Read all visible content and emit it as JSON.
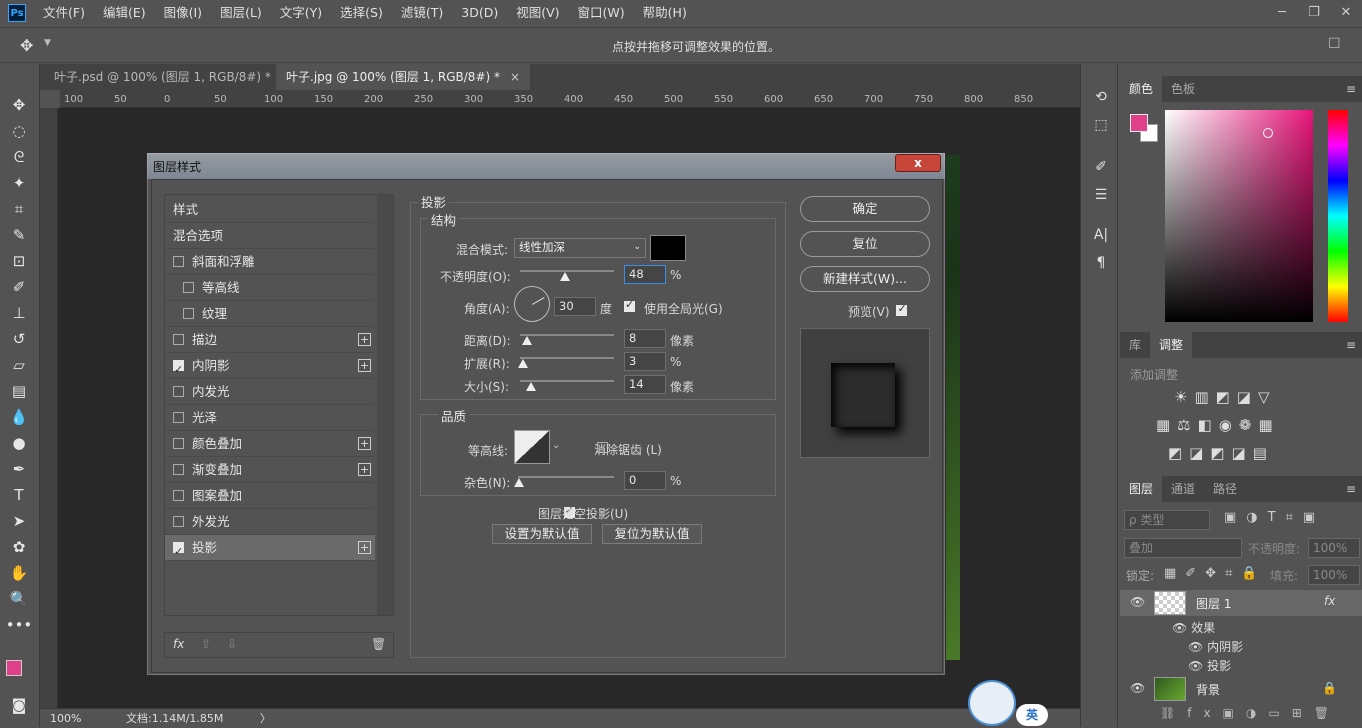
{
  "app": {
    "logo": "Ps"
  },
  "menu": [
    "文件(F)",
    "编辑(E)",
    "图像(I)",
    "图层(L)",
    "文字(Y)",
    "选择(S)",
    "滤镜(T)",
    "3D(D)",
    "视图(V)",
    "窗口(W)",
    "帮助(H)"
  ],
  "options_bar": {
    "hint": "点按并拖移可调整效果的位置。"
  },
  "doc_tabs": [
    {
      "label": "叶子.psd @ 100% (图层 1, RGB/8#) *",
      "close": "×"
    },
    {
      "label": "叶子.jpg @ 100% (图层 1, RGB/8#) *",
      "close": "×"
    }
  ],
  "ruler_h": [
    "100",
    "50",
    "0",
    "50",
    "100",
    "150",
    "200",
    "250",
    "300",
    "350",
    "400",
    "450",
    "500",
    "550",
    "600",
    "650",
    "700",
    "750",
    "800",
    "850"
  ],
  "status": {
    "zoom": "100%",
    "doc": "文档:1.14M/1.85M",
    "arrow": "〉"
  },
  "dialog": {
    "title": "图层样式",
    "close": "x",
    "styles": [
      {
        "label": "样式",
        "checkbox": null,
        "plus": false,
        "indent": false
      },
      {
        "label": "混合选项",
        "checkbox": null,
        "plus": false,
        "indent": false
      },
      {
        "label": "斜面和浮雕",
        "checkbox": false,
        "plus": false,
        "indent": false
      },
      {
        "label": "等高线",
        "checkbox": false,
        "plus": false,
        "indent": true
      },
      {
        "label": "纹理",
        "checkbox": false,
        "plus": false,
        "indent": true
      },
      {
        "label": "描边",
        "checkbox": false,
        "plus": true,
        "indent": false
      },
      {
        "label": "内阴影",
        "checkbox": true,
        "plus": true,
        "indent": false
      },
      {
        "label": "内发光",
        "checkbox": false,
        "plus": false,
        "indent": false
      },
      {
        "label": "光泽",
        "checkbox": false,
        "plus": false,
        "indent": false
      },
      {
        "label": "颜色叠加",
        "checkbox": false,
        "plus": true,
        "indent": false
      },
      {
        "label": "渐变叠加",
        "checkbox": false,
        "plus": true,
        "indent": false
      },
      {
        "label": "图案叠加",
        "checkbox": false,
        "plus": false,
        "indent": false
      },
      {
        "label": "外发光",
        "checkbox": false,
        "plus": false,
        "indent": false
      },
      {
        "label": "投影",
        "checkbox": true,
        "plus": true,
        "indent": false,
        "selected": true
      }
    ],
    "footer": {
      "fx": "fx"
    },
    "section_title": "投影",
    "structure": {
      "title": "结构",
      "blend_label": "混合模式:",
      "blend_value": "线性加深",
      "opacity_label": "不透明度(O):",
      "opacity_value": "48",
      "opacity_unit": "%",
      "opacity_level": 0.48,
      "angle_label": "角度(A):",
      "angle_value": "30",
      "angle_unit": "度",
      "global_light_label": "使用全局光(G)",
      "global_light": true,
      "distance_label": "距离(D):",
      "distance_value": "8",
      "distance_unit": "像素",
      "spread_label": "扩展(R):",
      "spread_value": "3",
      "spread_unit": "%",
      "size_label": "大小(S):",
      "size_value": "14",
      "size_unit": "像素",
      "shadow_color": "#000000"
    },
    "quality": {
      "title": "品质",
      "contour_label": "等高线:",
      "antialias_label": "消除锯齿 (L)",
      "antialias": false,
      "noise_label": "杂色(N):",
      "noise_value": "0",
      "noise_unit": "%"
    },
    "knockout_label": "图层挖空投影(U)",
    "knockout": true,
    "set_default": "设置为默认值",
    "reset_default": "复位为默认值",
    "buttons": {
      "ok": "确定",
      "reset": "复位",
      "new_style": "新建样式(W)...",
      "preview": "预览(V)"
    },
    "preview_checked": true
  },
  "color_panel": {
    "tabs": [
      "颜色",
      "色板"
    ],
    "fg": "#e0408a",
    "bg": "#ffffff"
  },
  "adjust_panel": {
    "tabs": [
      "库",
      "调整"
    ],
    "add_label": "添加调整"
  },
  "layers_panel": {
    "tabs": [
      "图层",
      "通道",
      "路径"
    ],
    "filter_label": "ρ 类型",
    "blend": "叠加",
    "opacity_label": "不透明度:",
    "opacity_value": "100%",
    "lock_label": "锁定:",
    "fill_label": "填充:",
    "fill_value": "100%",
    "layers": [
      {
        "name": "图层 1",
        "fx": "fx"
      },
      {
        "name": "效果"
      },
      {
        "name": "内阴影"
      },
      {
        "name": "投影"
      },
      {
        "name": "背景"
      }
    ]
  },
  "ime": {
    "label": "英"
  }
}
